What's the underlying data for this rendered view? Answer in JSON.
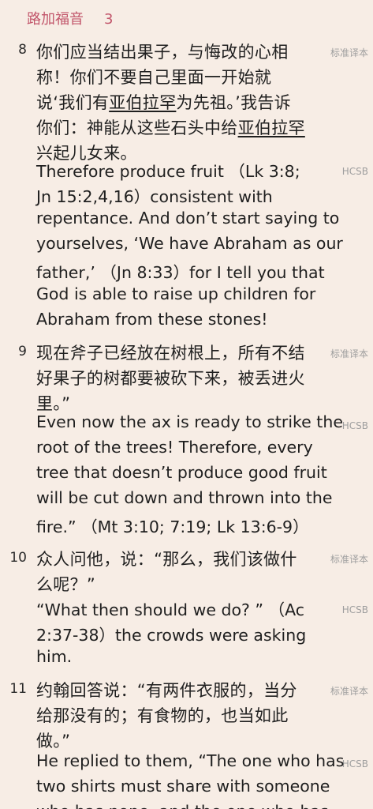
{
  "header": {
    "book": "路加福音",
    "chapter": "3"
  },
  "tags": {
    "zh": "标准译本",
    "en": "HCSB"
  },
  "verses": [
    {
      "num": "8",
      "zh": [
        "你们应当结出果子，与悔改的心相",
        "称！你们不要自己里面一开始就",
        [
          "说‘我们有",
          "亚伯拉罕",
          "为先祖。’我告诉"
        ],
        [
          "你们：神能从这些石头中给",
          "亚伯拉罕",
          ""
        ],
        "兴起儿女来。"
      ],
      "en": [
        "Therefore produce fruit （Lk 3:8;",
        "Jn 15:2,4,16）consistent with",
        "repentance. And don’t start saying to",
        "yourselves, ‘We have Abraham as our",
        "father,’ （Jn 8:33）for I tell you that",
        "God is able to raise up children for",
        "Abraham from these stones!"
      ]
    },
    {
      "num": "9",
      "zh": [
        "现在斧子已经放在树根上，所有不结",
        "好果子的树都要被砍下来，被丢进火",
        "里。”"
      ],
      "en": [
        "Even now the ax is ready to strike the",
        "root of the trees! Therefore, every",
        "tree that doesn’t produce good fruit",
        "will be cut down and thrown into the",
        "fire.” （Mt 3:10; 7:19; Lk 13:6-9）"
      ]
    },
    {
      "num": "10",
      "zh": [
        "众人问他，说：“那么，我们该做什",
        "么呢？”"
      ],
      "en": [
        "“What then should we do? ” （Ac",
        "2:37-38）the crowds were asking",
        "him."
      ]
    },
    {
      "num": "11",
      "zh": [
        "约翰回答说：“有两件衣服的，当分",
        "给那没有的；有食物的，也当如此",
        "做。”"
      ],
      "en": [
        "He replied to them, “The one who has",
        "two shirts must share with someone",
        "who has none, and the one who has"
      ]
    }
  ]
}
